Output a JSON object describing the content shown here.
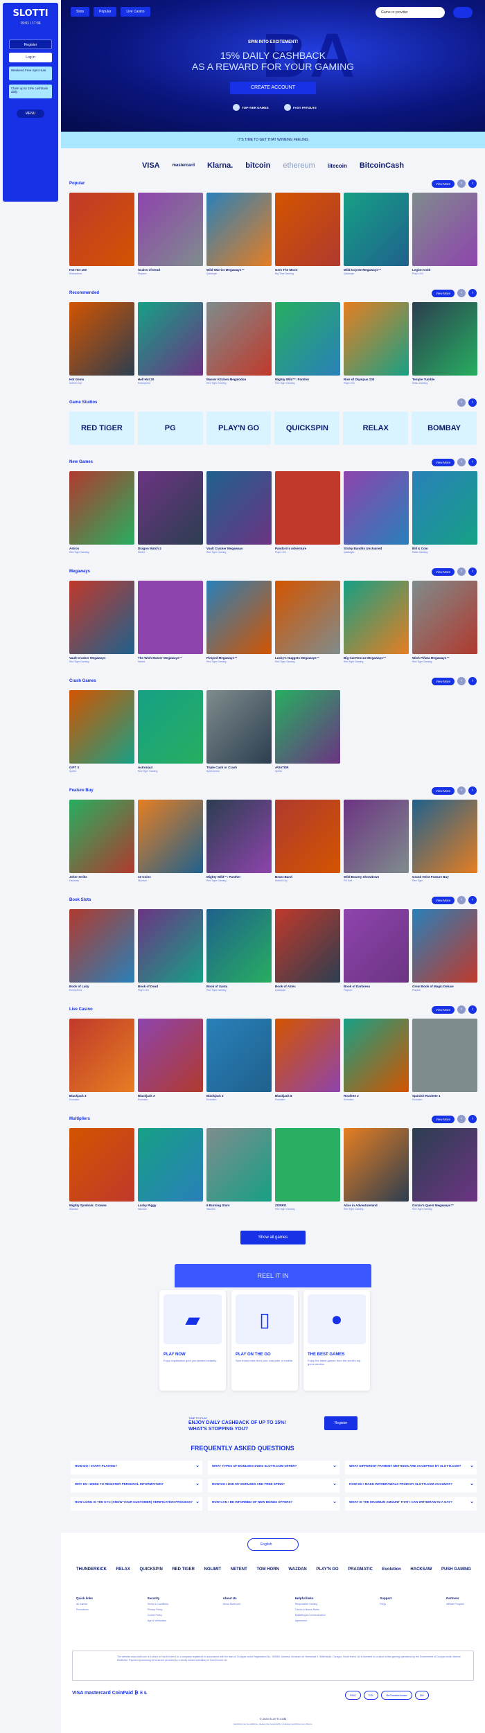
{
  "brand": {
    "logo": "SLOTTI",
    "clock": "19:01 / 17:36"
  },
  "sidebar": {
    "register": "Register",
    "login": "Log in",
    "promo1": "Weekend Free Spin Hunt",
    "promo2": "Claim up to 15% cashback daily",
    "menu": "MENU"
  },
  "nav": {
    "items": [
      "Slots",
      "Popular",
      "Live Casino"
    ],
    "search_placeholder": "Game or provider"
  },
  "hero": {
    "kicker": "SPIN INTO EXCITEMENT!",
    "title1": "15% DAILY CASHBACK",
    "title2": "AS A REWARD FOR YOUR GAMING",
    "cta": "CREATE ACCOUNT",
    "feat1": "TOP-TIER GAMES",
    "feat2": "FAST PAYOUTS",
    "bg": "BA"
  },
  "banner": "IT'S TIME TO GET THAT WINNING FEELING",
  "payments": [
    "VISA",
    "mastercard",
    "Klarna.",
    "bitcoin",
    "ethereum",
    "litecoin",
    "BitcoinCash"
  ],
  "view_more": "View More",
  "sections": [
    {
      "title": "Popular",
      "games": [
        [
          "Hot Hot 100",
          "Endorphina"
        ],
        [
          "Scales of Dead",
          "Playson"
        ],
        [
          "Wild Warrior Megaways™",
          "Quickspin"
        ],
        [
          "Gem The Moon",
          "Big Time Gaming"
        ],
        [
          "Wild Coyote Megaways™",
          "Quickspin"
        ],
        [
          "Legion Gold",
          "Play'n GO"
        ]
      ]
    },
    {
      "title": "Recommended",
      "games": [
        [
          "Hot Gems",
          "Nolimit City"
        ],
        [
          "Hell Hot 20",
          "Endorphina"
        ],
        [
          "Master Kitchen Megalodon",
          "Red Tiger Gaming"
        ],
        [
          "Mighty Wild™: Panther",
          "Red Tiger Gaming"
        ],
        [
          "Rise of Olympus 100",
          "Play'n GO"
        ],
        [
          "Temple Tumble",
          "Relax Gaming"
        ]
      ]
    },
    {
      "title": "Game Studios",
      "studios": [
        "RED TIGER",
        "PG",
        "PLAY'N GO",
        "QUICKSPIN",
        "RELAX",
        "BOMBAY"
      ]
    },
    {
      "title": "New Games",
      "games": [
        [
          "Astros",
          "Red Tiger Gaming"
        ],
        [
          "Dragon Match 2",
          "Netent"
        ],
        [
          "Vault Cracker Megaways",
          "Red Tiger Gaming"
        ],
        [
          "Pandoro's Adventure",
          "Play'n GO"
        ],
        [
          "Sticky Bandits Unchained",
          "Quickspin"
        ],
        [
          "Bill & Coin",
          "Relax Gaming"
        ]
      ]
    },
    {
      "title": "Megaways",
      "games": [
        [
          "Vault Cracker Megaways",
          "Red Tiger Gaming"
        ],
        [
          "The Wish Master Megaways™",
          "Netent"
        ],
        [
          "Pimped Megaways™",
          "Red Tiger Gaming"
        ],
        [
          "Lucky's Nuggets Megaways™",
          "Red Tiger Gaming"
        ],
        [
          "Big Cat Rescue Megaways™",
          "Red Tiger Gaming"
        ],
        [
          "Wish Piñata Megaways™",
          "Red Tiger Gaming"
        ]
      ]
    },
    {
      "title": "Crash Games",
      "games": [
        [
          "GIFT X",
          "Spribe"
        ],
        [
          "Astronaut",
          "Red Tiger Gaming"
        ],
        [
          "Triple Cash or Crash",
          "Spinomenal"
        ],
        [
          "AVIATOR",
          "Spribe"
        ]
      ]
    },
    {
      "title": "Feature Buy",
      "games": [
        [
          "Joker Strike",
          "Hacksaw"
        ],
        [
          "10 Coins",
          "Wazdan"
        ],
        [
          "Mighty Wild™: Panther",
          "Red Tiger Gaming"
        ],
        [
          "Beast Band",
          "Nolimit City"
        ],
        [
          "Wild Bounty Showdown",
          "PG Soft"
        ],
        [
          "Grand Heist Feature Buy",
          "Red Tiger"
        ]
      ]
    },
    {
      "title": "Book Slots",
      "games": [
        [
          "Book of Lady",
          "Endorphina"
        ],
        [
          "Book of Dead",
          "Play'n GO"
        ],
        [
          "Book of Santa",
          "Red Tiger Gaming"
        ],
        [
          "Book of Aztec",
          "Quickspin"
        ],
        [
          "Book of Darkness",
          "Playson"
        ],
        [
          "Great Book of Magic Deluxe",
          "Playson"
        ]
      ]
    },
    {
      "title": "Live Casino",
      "games": [
        [
          "Blackjack 3",
          "Evolution"
        ],
        [
          "Blackjack A",
          "Evolution"
        ],
        [
          "Blackjack 2",
          "Evolution"
        ],
        [
          "Blackjack 8",
          "Evolution"
        ],
        [
          "Roulette 2",
          "Evolution"
        ],
        [
          "Spanish Roulette 1",
          "Evolution"
        ]
      ]
    },
    {
      "title": "Multipliers",
      "games": [
        [
          "Mighty Symbols: Crowns",
          "Wazdan"
        ],
        [
          "Lucky Piggy",
          "Wazdan"
        ],
        [
          "9 Burning Stars",
          "Wazdan"
        ],
        [
          "ZORRO",
          "Red Tiger Gaming"
        ],
        [
          "Alice in Adventureland",
          "Red Tiger Gaming"
        ],
        [
          "Gonzo's Quest Megaways™",
          "Red Tiger Gaming"
        ]
      ]
    }
  ],
  "show_all": "Show all games",
  "reel": {
    "title": "REEL IT IN",
    "cards": [
      {
        "h": "PLAY NOW",
        "p": "Enjoy registration gets you started instantly."
      },
      {
        "h": "PLAY ON THE GO",
        "p": "Spin those reels from your computer or mobile."
      },
      {
        "h": "THE BEST GAMES",
        "p": "Enjoy the latest games from the world's top game studios."
      }
    ]
  },
  "enjoy": {
    "small": "TIME TO PLAY",
    "line1": "ENJOY DAILY CASHBACK OF UP TO 15%!",
    "line2": "WHAT'S STOPPING YOU?",
    "button": "Register"
  },
  "faq": {
    "title": "FREQUENTLY ASKED QUESTIONS",
    "items": [
      "HOW DO I START PLAYING?",
      "WHAT TYPES OF BONUSES DOES SLOTTI.COM OFFER?",
      "WHAT DIFFERENT PAYMENT METHODS ARE ACCEPTED BY SLOTTI.COM?",
      "WHY DO I NEED TO REGISTER PERSONAL INFORMATION?",
      "HOW DO I USE MY BONUSES AND FREE SPINS?",
      "HOW DO I MAKE WITHDRAWALS FROM MY SLOTTI.COM ACCOUNT?",
      "HOW LONG IS THE KYC (KNOW YOUR CUSTOMER) VERIFICATION PROCESS?",
      "HOW CAN I BE INFORMED OF NEW BONUS OFFERS?",
      "WHAT IS THE MAXIMUM AMOUNT THAT I CAN WITHDRAW IN A DAY?"
    ]
  },
  "footer": {
    "language": "English",
    "providers": [
      "THUNDERKICK",
      "RELAX",
      "QUICKSPIN",
      "RED TIGER",
      "NOLIMIT",
      "NETENT",
      "TOM HORN",
      "WAZDAN",
      "PLAY'N GO",
      "PRAGMATIC",
      "Evolution",
      "HACKSAW",
      "PUSH GAMING"
    ],
    "cols": [
      {
        "h": "Quick links",
        "l": [
          "All Games",
          "Promotions"
        ]
      },
      {
        "h": "Security",
        "l": [
          "Terms & Conditions",
          "Privacy Policy",
          "Cookie Policy",
          "Age & Verification"
        ]
      },
      {
        "h": "About Us",
        "l": [
          "About Slotti.com"
        ]
      },
      {
        "h": "Helpful links",
        "l": [
          "Responsible Gaming",
          "Casino & Bonus Rules",
          "Marketing & Communication",
          "Agreement"
        ]
      },
      {
        "h": "Support",
        "l": [
          "FAQs"
        ]
      },
      {
        "h": "Partners",
        "l": [
          "Affiliate Program"
        ]
      }
    ],
    "legal": "The website www.slotti.com is a brand of Nordi Invest Ltd. a company registered in accordance with the laws of Curaçao under Registration No. 159669. Address: Abraham de Veerstraat 9, Willemstad, Curaçao. Nordi Invest Ltd is licensed to conduct online gaming operations by the Government of Curaçao under license 8048/JAZ. Payment processing services are provided by a wholly owned subsidiary of Nordi Invest Ltd.",
    "pay": "VISA  mastercard  CoinPaid  ₿ Ξ Ł",
    "badges": [
      "RNG",
      "SSL",
      "BeGambleAware",
      "18+"
    ],
    "copyright": "© 2024 SLOTTI.COM",
    "disclaimer": "Gambling can be addictive, please play responsibly. Underage gambling is an offence."
  }
}
